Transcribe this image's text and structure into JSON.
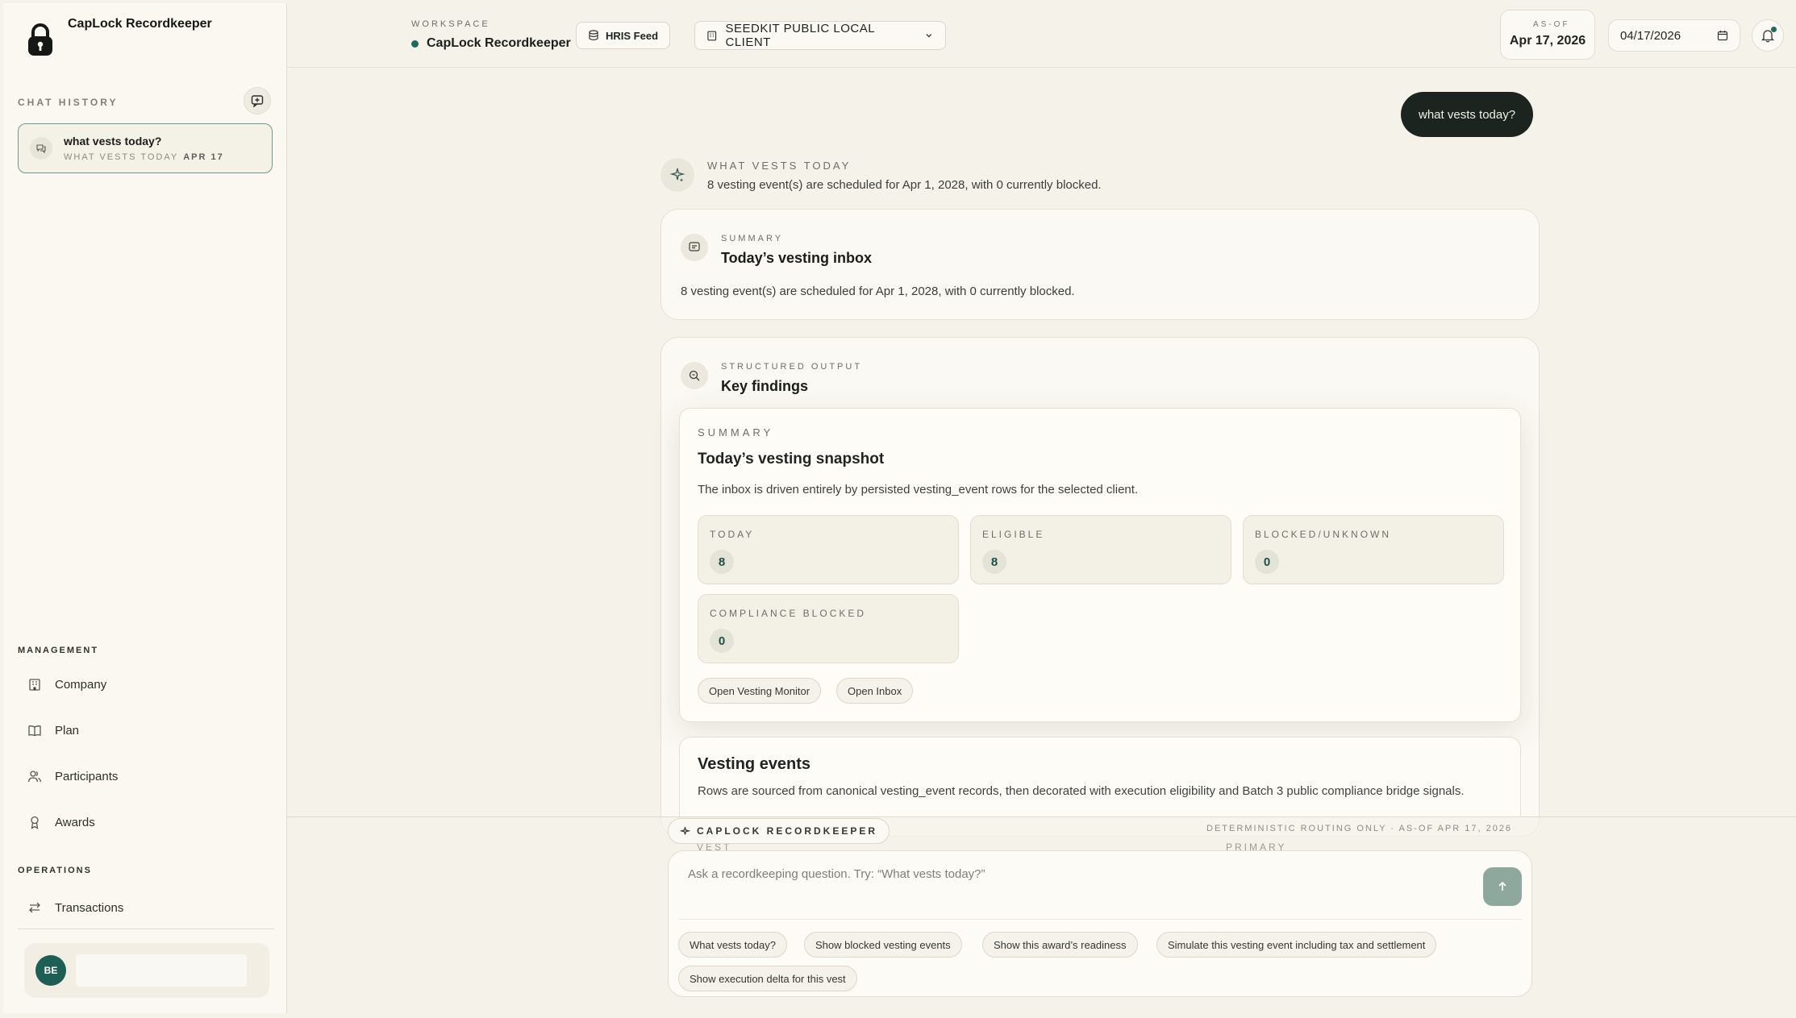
{
  "app": {
    "name": "CapLock Recordkeeper"
  },
  "sidebar": {
    "chat_history_label": "Chat History",
    "chat_items": [
      {
        "title": "what vests today?",
        "meta": "What vests today",
        "date": "APR 17"
      }
    ],
    "management_label": "Management",
    "management_items": [
      {
        "label": "Company",
        "icon": "building-icon"
      },
      {
        "label": "Plan",
        "icon": "book-icon"
      },
      {
        "label": "Participants",
        "icon": "users-icon"
      },
      {
        "label": "Awards",
        "icon": "award-icon"
      }
    ],
    "operations_label": "Operations",
    "operations_items": [
      {
        "label": "Transactions",
        "icon": "arrows-icon"
      }
    ],
    "user": {
      "initials": "BE"
    }
  },
  "header": {
    "workspace_label": "Workspace",
    "workspace_name": "CapLock Recordkeeper",
    "hris_label": "HRIS Feed",
    "client_selected": "SEEDKIT PUBLIC LOCAL CLIENT",
    "asof_label": "As-of",
    "asof_value": "Apr 17, 2026",
    "date_value": "04/17/2026"
  },
  "chat": {
    "user_message": "what vests today?",
    "reply_title": "What vests today",
    "reply_sub": "8 vesting event(s) are scheduled for Apr 1, 2028, with 0 currently blocked.",
    "summary_card": {
      "kicker": "Summary",
      "title": "Today’s vesting inbox",
      "body": "8 vesting event(s) are scheduled for Apr 1, 2028, with 0 currently blocked."
    },
    "structured_card": {
      "kicker": "Structured Output",
      "title": "Key findings"
    },
    "snapshot": {
      "kicker": "Summary",
      "title": "Today’s vesting snapshot",
      "desc": "The inbox is driven entirely by persisted vesting_event rows for the selected client.",
      "stats": [
        {
          "label": "Today",
          "value": "8"
        },
        {
          "label": "Eligible",
          "value": "8"
        },
        {
          "label": "Blocked/Unknown",
          "value": "0"
        },
        {
          "label": "Compliance Blocked",
          "value": "0"
        }
      ],
      "actions": [
        "Open Vesting Monitor",
        "Open Inbox"
      ]
    },
    "vesting_events": {
      "title": "Vesting events",
      "desc": "Rows are sourced from canonical vesting_event records, then decorated with execution eligibility and Batch 3 public compliance bridge signals.",
      "col_vest": "Vest",
      "col_primary": "Primary"
    }
  },
  "composer": {
    "agent_label": "CapLock Recordkeeper",
    "routing_note": "Deterministic routing only · As-of Apr 17, 2026",
    "placeholder": "Ask a recordkeeping question. Try: “What vests today?”",
    "suggestions": [
      "What vests today?",
      "Show blocked vesting events",
      "Show this award’s readiness",
      "Simulate this vesting event including tax and settlement",
      "Show execution delta for this vest"
    ]
  },
  "colors": {
    "accent": "#1d6b5d",
    "dark_bubble": "#1c2420",
    "send_button": "#8fa89d"
  }
}
